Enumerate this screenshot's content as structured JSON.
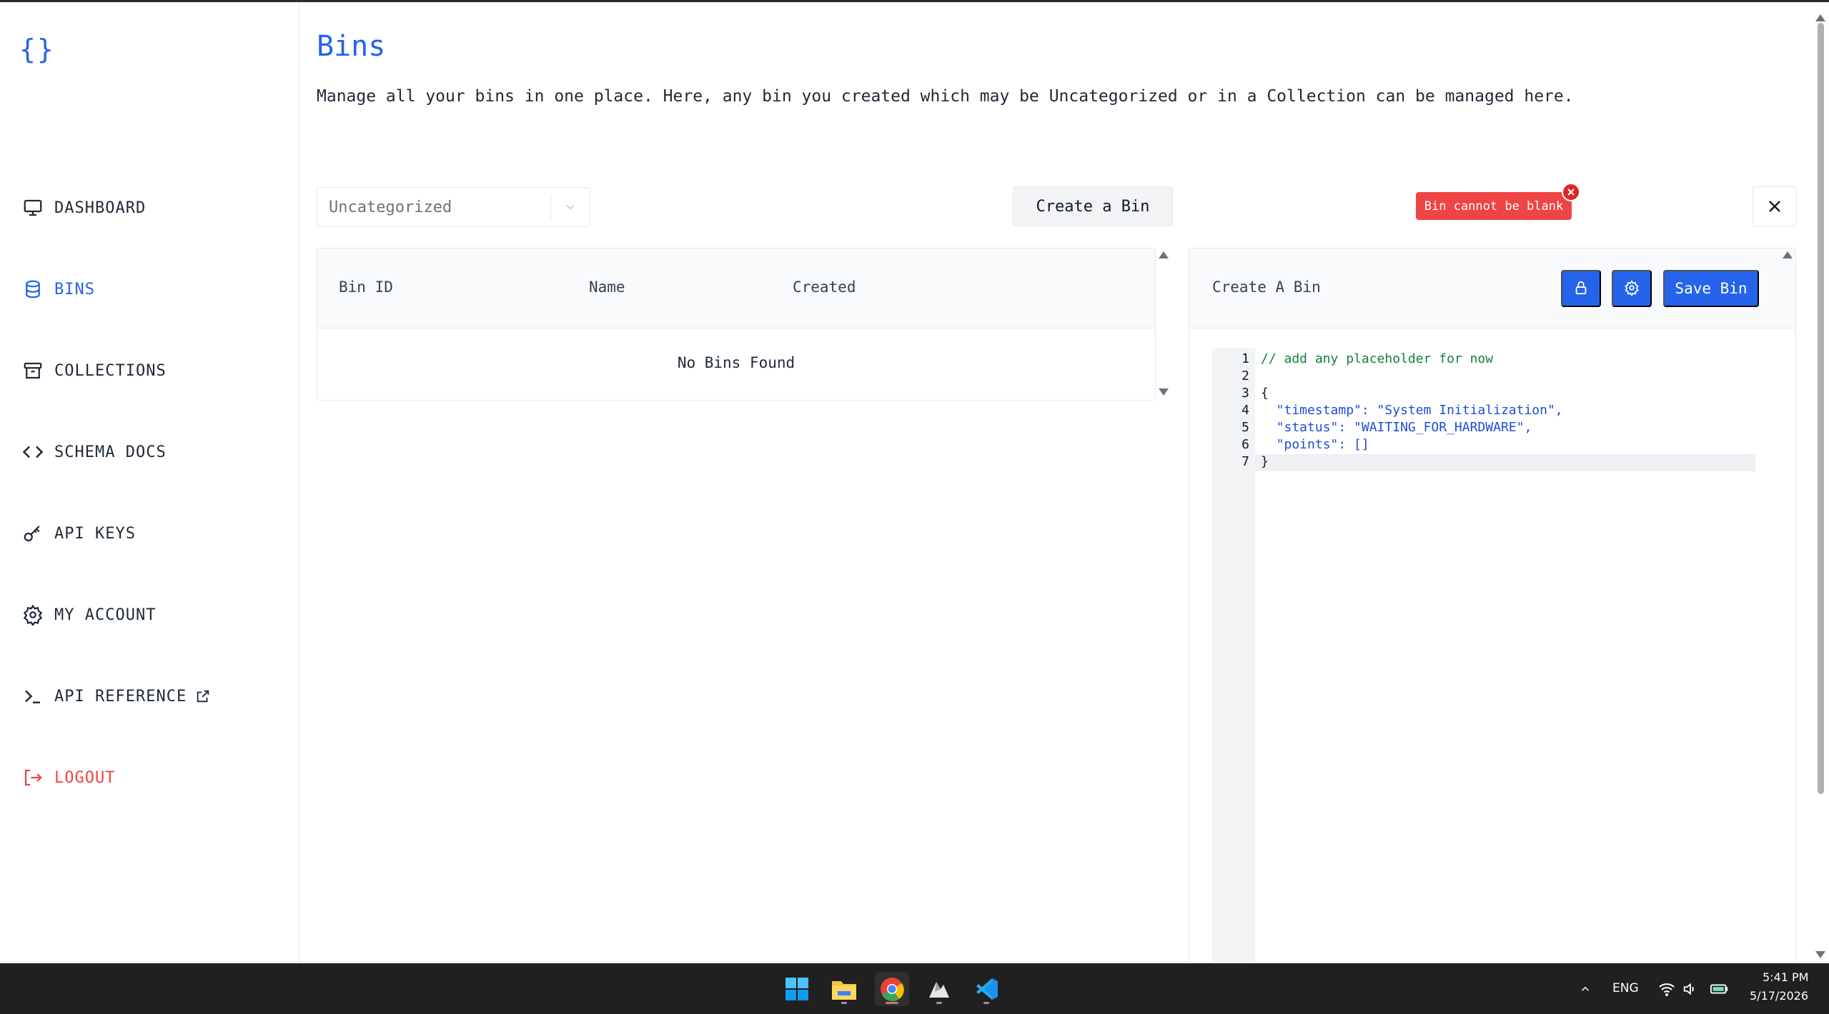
{
  "app": {
    "logo_text": "{}",
    "page_title": "Bins",
    "page_description": "Manage all your bins in one place. Here, any bin you created which may be Uncategorized or in a Collection can be managed here."
  },
  "sidebar": {
    "items": [
      {
        "label": "DASHBOARD",
        "icon": "monitor-icon",
        "active": false
      },
      {
        "label": "BINS",
        "icon": "database-icon",
        "active": true
      },
      {
        "label": "COLLECTIONS",
        "icon": "archive-icon",
        "active": false
      },
      {
        "label": "SCHEMA DOCS",
        "icon": "code-icon",
        "active": false
      },
      {
        "label": "API KEYS",
        "icon": "key-icon",
        "active": false
      },
      {
        "label": "MY ACCOUNT",
        "icon": "gear-icon",
        "active": false
      },
      {
        "label": "API REFERENCE",
        "icon": "terminal-icon",
        "active": false,
        "external": true
      },
      {
        "label": "LOGOUT",
        "icon": "logout-icon",
        "active": false
      }
    ]
  },
  "toolbar": {
    "collection_select_value": "Uncategorized",
    "create_bin_label": "Create a Bin",
    "error_message": "Bin cannot be blank"
  },
  "table": {
    "columns": [
      "Bin ID",
      "Name",
      "Created"
    ],
    "empty_text": "No Bins Found"
  },
  "editor": {
    "title": "Create A Bin",
    "save_label": "Save Bin",
    "line_numbers": [
      "1",
      "2",
      "3",
      "4",
      "5",
      "6",
      "7"
    ],
    "lines": [
      "// add any placeholder for now",
      "",
      "{",
      "  \"timestamp\": \"System Initialization\",",
      "  \"status\": \"WAITING_FOR_HARDWARE\",",
      "  \"points\": []",
      "}"
    ]
  },
  "taskbar": {
    "apps": [
      "windows-start-icon",
      "file-explorer-icon",
      "chrome-icon",
      "app-icon",
      "vscode-icon"
    ],
    "language": "ENG",
    "time": "5:41 PM",
    "date": "5/17/2026"
  },
  "colors": {
    "accent": "#2563eb",
    "error": "#ef4444",
    "logout": "#ef4444"
  }
}
